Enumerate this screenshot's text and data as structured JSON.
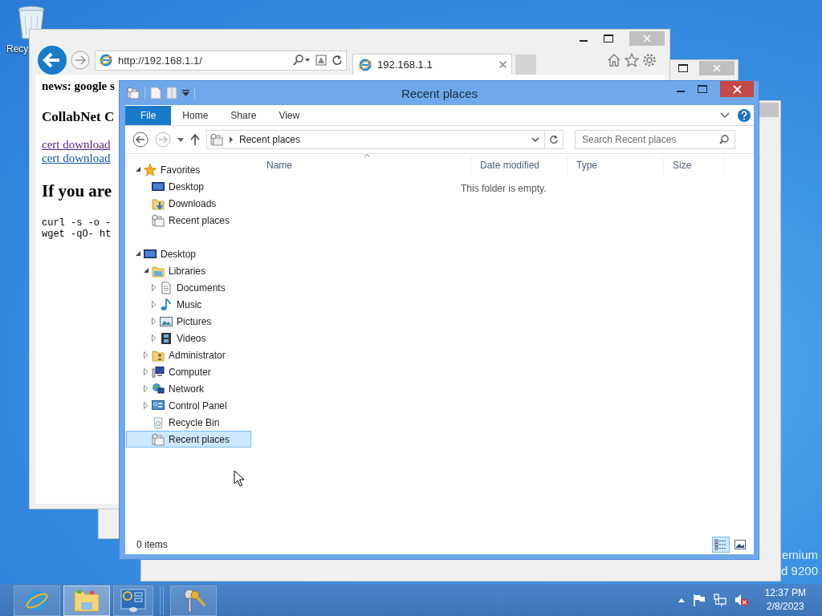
{
  "desktop": {
    "icons": [
      {
        "label": "Recy"
      }
    ],
    "edition_text": [
      "emium",
      "d 9200"
    ]
  },
  "browser": {
    "address": "http://192.168.1.1/",
    "tab": {
      "title": "192.168.1.1"
    },
    "content": {
      "news": "news: google s",
      "subheading": "CollabNet C",
      "links": [
        {
          "text": "cert download",
          "visited": true
        },
        {
          "text": "cert download",
          "visited": false
        }
      ],
      "heading": "If you are",
      "code": [
        "curl -s -o -",
        "wget -qO- ht"
      ]
    }
  },
  "explorer": {
    "title": "Recent places",
    "ribbon_tabs": [
      {
        "label": "File",
        "selected": true
      },
      {
        "label": "Home",
        "selected": false
      },
      {
        "label": "Share",
        "selected": false
      },
      {
        "label": "View",
        "selected": false
      }
    ],
    "address": {
      "path": "Recent places"
    },
    "search": {
      "placeholder": "Search Recent places"
    },
    "tree": [
      {
        "label": "Favorites",
        "kind": "star",
        "has_children": true,
        "expanded": true,
        "selected": false,
        "children": [
          {
            "label": "Desktop",
            "kind": "monitor",
            "has_children": false,
            "selected": false
          },
          {
            "label": "Downloads",
            "kind": "downloads",
            "has_children": false,
            "selected": false
          },
          {
            "label": "Recent places",
            "kind": "recent",
            "has_children": false,
            "selected": false
          }
        ]
      },
      {
        "label": "Desktop",
        "kind": "monitor",
        "has_children": true,
        "expanded": true,
        "selected": false,
        "children": [
          {
            "label": "Libraries",
            "kind": "library",
            "has_children": true,
            "expanded": true,
            "selected": false,
            "children": [
              {
                "label": "Documents",
                "kind": "document",
                "has_children": true,
                "expanded": false,
                "selected": false
              },
              {
                "label": "Music",
                "kind": "music",
                "has_children": true,
                "expanded": false,
                "selected": false
              },
              {
                "label": "Pictures",
                "kind": "pictures",
                "has_children": true,
                "expanded": false,
                "selected": false
              },
              {
                "label": "Videos",
                "kind": "videos",
                "has_children": true,
                "expanded": false,
                "selected": false
              }
            ]
          },
          {
            "label": "Administrator",
            "kind": "user",
            "has_children": true,
            "expanded": false,
            "selected": false
          },
          {
            "label": "Computer",
            "kind": "computer",
            "has_children": true,
            "expanded": false,
            "selected": false
          },
          {
            "label": "Network",
            "kind": "network",
            "has_children": true,
            "expanded": false,
            "selected": false
          },
          {
            "label": "Control Panel",
            "kind": "control",
            "has_children": true,
            "expanded": false,
            "selected": false
          },
          {
            "label": "Recycle Bin",
            "kind": "recycle",
            "has_children": false,
            "selected": false
          },
          {
            "label": "Recent places",
            "kind": "recent",
            "has_children": false,
            "selected": true
          }
        ]
      }
    ],
    "columns": [
      "Name",
      "Date modified",
      "Type",
      "Size"
    ],
    "empty_message": "This folder is empty.",
    "status": "0 items",
    "views": [
      {
        "kind": "details",
        "selected": true
      },
      {
        "kind": "tiles",
        "selected": false
      }
    ]
  },
  "taskbar": {
    "apps": [
      {
        "kind": "browser",
        "active": false
      },
      {
        "kind": "explorer",
        "active": true
      },
      {
        "kind": "server",
        "active": false
      },
      {
        "kind": "keys",
        "active": false
      }
    ],
    "clock": {
      "time": "12:37 PM",
      "date": "2/8/2023"
    }
  }
}
